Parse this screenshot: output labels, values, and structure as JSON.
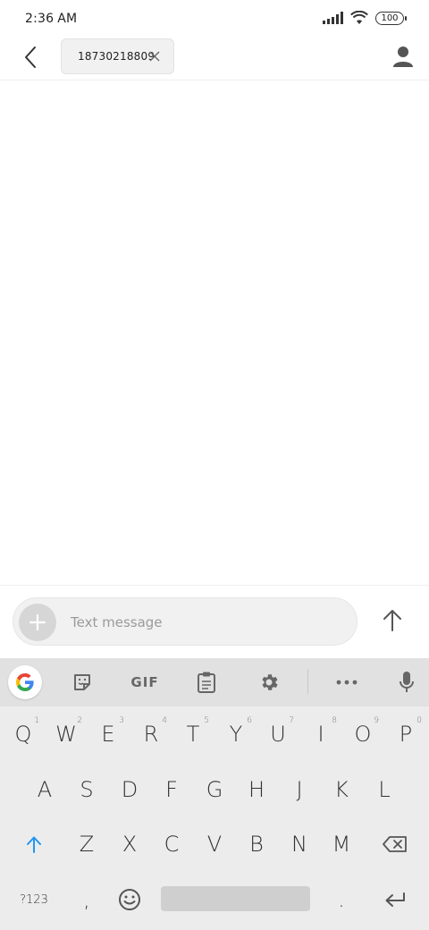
{
  "status_bar": {
    "time": "2:36",
    "ampm": "AM",
    "battery": "100"
  },
  "header": {
    "recipient_chip": "18730218809"
  },
  "compose": {
    "placeholder": "Text message"
  },
  "keyboard": {
    "toolbar": {
      "gif_label": "GIF"
    },
    "row1": [
      {
        "key": "Q",
        "hint": "1"
      },
      {
        "key": "W",
        "hint": "2"
      },
      {
        "key": "E",
        "hint": "3"
      },
      {
        "key": "R",
        "hint": "4"
      },
      {
        "key": "T",
        "hint": "5"
      },
      {
        "key": "Y",
        "hint": "6"
      },
      {
        "key": "U",
        "hint": "7"
      },
      {
        "key": "I",
        "hint": "8"
      },
      {
        "key": "O",
        "hint": "9"
      },
      {
        "key": "P",
        "hint": "0"
      }
    ],
    "row2": [
      "A",
      "S",
      "D",
      "F",
      "G",
      "H",
      "J",
      "K",
      "L"
    ],
    "row3": [
      "Z",
      "X",
      "C",
      "V",
      "B",
      "N",
      "M"
    ],
    "row4": {
      "symbols": "?123",
      "comma": ",",
      "period": "."
    }
  },
  "colors": {
    "accent_blue": "#2196f3",
    "keyboard_bg": "#ececec",
    "toolbar_bg": "#e1e1e1"
  }
}
